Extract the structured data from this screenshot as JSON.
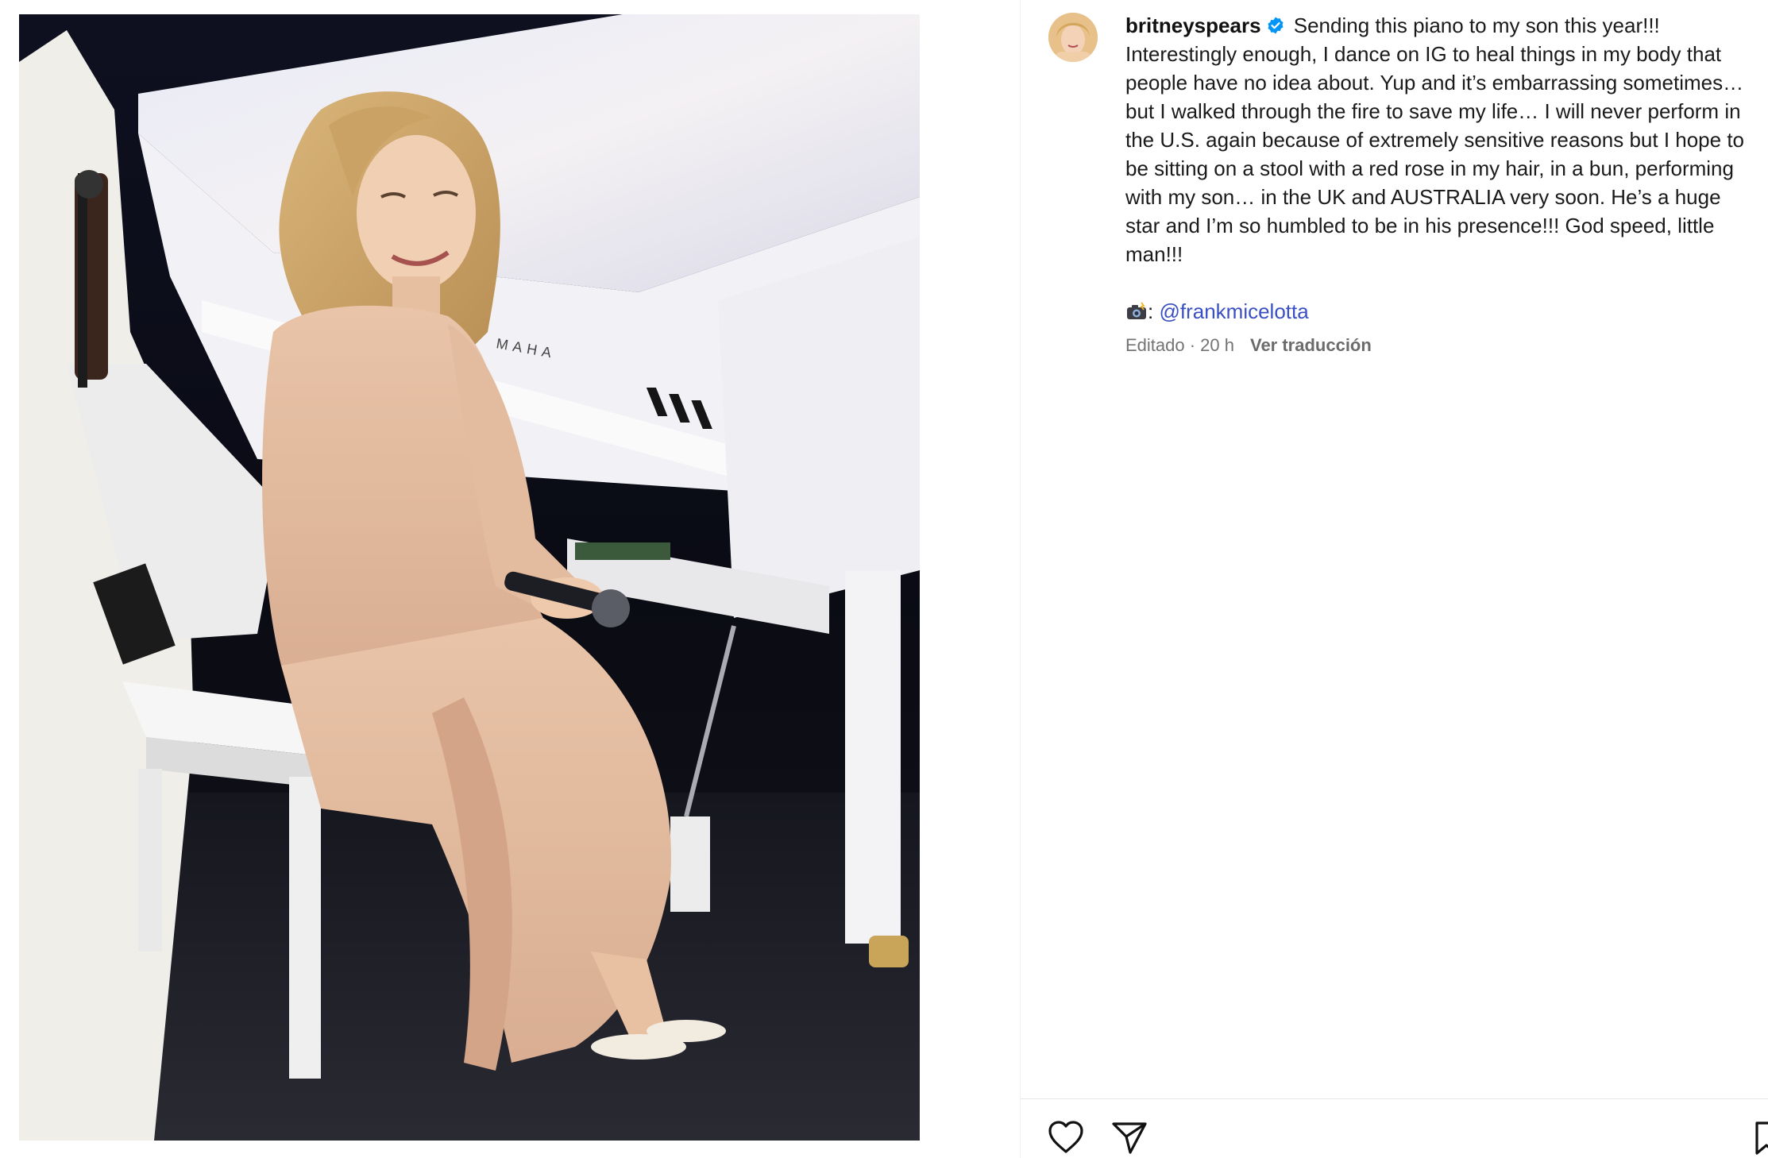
{
  "post": {
    "image_alt": "Photo of a woman in a sheer nude dress seated on a white piano bench beside a white YAMAHA grand piano on stage",
    "piano_brand_text": "MAHA"
  },
  "caption": {
    "username": "britneyspears",
    "verified": true,
    "text": "Sending this piano to my son this year!!! Interestingly enough, I dance on IG to heal things in my body that people have no idea about. Yup and it’s embarrassing sometimes… but I walked through the fire to save my life… I will never perform in the U.S. again because of extremely sensitive reasons but I hope to be sitting on a stool with a red rose in my hair, in a bun, performing with my son… in the UK and AUSTRALIA very soon. He’s a huge star and I’m so humbled to be in his presence!!! God speed, little man!!!",
    "credit_prefix": ":",
    "credit_mention": "@frankmicelotta",
    "edited_label": "Editado · 20 h",
    "translate_label": "Ver traducción"
  },
  "icons": {
    "verified": "verified-badge-icon",
    "camera": "camera-with-flash-icon",
    "like": "heart-outline-icon",
    "share": "paper-plane-icon",
    "save": "bookmark-icon"
  },
  "colors": {
    "verified_blue": "#0095f6",
    "mention_blue": "#3a4fc4",
    "meta_gray": "#737373",
    "text": "#1a1a1a"
  }
}
